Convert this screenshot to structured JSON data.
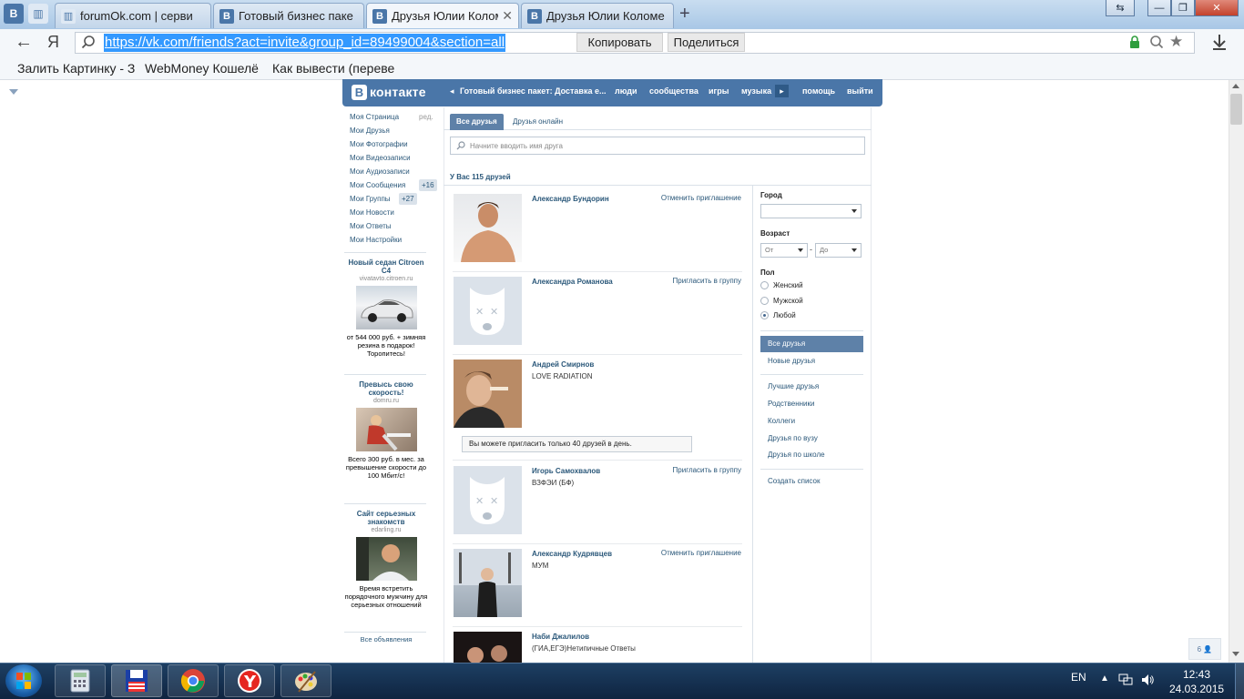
{
  "browser": {
    "tabs": [
      {
        "title": "forumOk.com | серви",
        "active": false
      },
      {
        "title": "Готовый бизнес паке",
        "active": false
      },
      {
        "title": "Друзья Юлии Коломе",
        "active": true
      },
      {
        "title": "Друзья Юлии Коломе",
        "active": false
      }
    ],
    "pinned_tabs": [
      "В",
      "||"
    ],
    "new_tab_glyph": "+",
    "window_controls": {
      "minimize": "—",
      "maximize": "❐",
      "close": "✕"
    },
    "back_glyph": "←",
    "yandex_glyph": "Я",
    "url": "https://vk.com/friends?act=invite&group_id=89499004&section=all",
    "copy_label": "Копировать",
    "share_label": "Поделиться",
    "bookmarks": [
      "Залить Картинку - З",
      "WebMoney Кошелё",
      "Как вывести (переве"
    ]
  },
  "vk": {
    "logo_letter": "В",
    "logo_text": "контакте",
    "nav_back": "◂",
    "nav": {
      "group": "Готовый бизнес пакет: Доставка е...",
      "people": "люди",
      "communities": "сообщества",
      "games": "игры",
      "music": "музыка",
      "more": "▸",
      "help": "помощь",
      "logout": "выйти"
    },
    "left_menu": [
      {
        "label": "Моя Страница",
        "extra": "ред."
      },
      {
        "label": "Мои Друзья",
        "extra": ""
      },
      {
        "label": "Мои Фотографии",
        "extra": ""
      },
      {
        "label": "Мои Видеозаписи",
        "extra": ""
      },
      {
        "label": "Мои Аудиозаписи",
        "extra": ""
      },
      {
        "label": "Мои Сообщения",
        "extra": "+16"
      },
      {
        "label": "Мои Группы",
        "extra": "+27"
      },
      {
        "label": "Мои Новости",
        "extra": ""
      },
      {
        "label": "Мои Ответы",
        "extra": ""
      },
      {
        "label": "Мои Настройки",
        "extra": ""
      }
    ],
    "ads": [
      {
        "title": "Новый седан Citroen C4",
        "domain": "vivatavto.citroen.ru",
        "text": "от 544 000 руб. + зимняя резина в подарок! Торопитесь!"
      },
      {
        "title": "Превысь свою скорость!",
        "domain": "domru.ru",
        "text": "Всего 300 руб. в мес. за превышение скорости до 100 Мбит/с!"
      },
      {
        "title": "Сайт серьезных знакомств",
        "domain": "edarling.ru",
        "text": "Время встретить порядочного мужчину для серьезных отношений"
      }
    ],
    "all_ads_label": "Все объявления",
    "tabs": {
      "all": "Все друзья",
      "online": "Друзья онлайн"
    },
    "search_placeholder": "Начните вводить имя друга",
    "summary": "У Вас 115 друзей",
    "friends": [
      {
        "name": "Александр Бундорин",
        "info": "",
        "action": "Отменить приглашение"
      },
      {
        "name": "Александра Романова",
        "info": "",
        "action": "Пригласить в группу"
      },
      {
        "name": "Андрей Смирнов",
        "info": "LOVE RADIATION",
        "action": ""
      },
      {
        "name": "Игорь Самохвалов",
        "info": "ВЗФЭИ (БФ)",
        "action": "Пригласить в группу"
      },
      {
        "name": "Александр Кудрявцев",
        "info": "МУМ",
        "action": "Отменить приглашение"
      },
      {
        "name": "Наби Джалилов",
        "info": "(ГИА,ЕГЭ)Нетипичные Ответы",
        "action": ""
      }
    ],
    "limit_notice": "Вы можете пригласить только 40 друзей в день.",
    "filters": {
      "city_label": "Город",
      "age_label": "Возраст",
      "age_from": "От",
      "age_dash": "-",
      "age_to": "До",
      "sex_label": "Пол",
      "sex_options": [
        "Женский",
        "Мужской",
        "Любой"
      ],
      "sex_selected": "Любой"
    },
    "sections": [
      "Все друзья",
      "Новые друзья"
    ],
    "lists": [
      "Лучшие друзья",
      "Родственники",
      "Коллеги",
      "Друзья по вузу",
      "Друзья по школе"
    ],
    "create_list": "Создать список",
    "online_counter": "6"
  },
  "taskbar": {
    "lang": "EN",
    "time": "12:43",
    "date": "24.03.2015"
  },
  "colors": {
    "vk_blue": "#4a76a8",
    "vk_link": "#2b587a",
    "tab_active": "#5e81a8",
    "url_highlight": "#3399ff"
  }
}
